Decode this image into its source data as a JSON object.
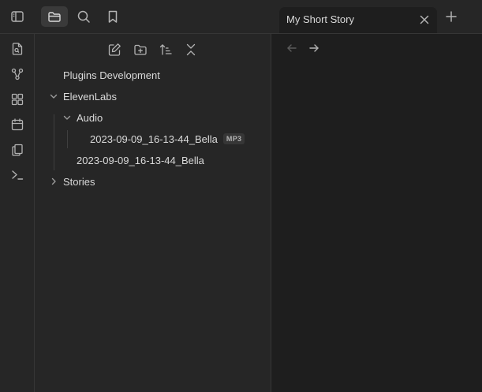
{
  "topbar": {
    "icons": [
      "sidebar-toggle-icon",
      "folder-icon",
      "search-icon",
      "bookmark-icon"
    ],
    "active_tab": "files"
  },
  "tab": {
    "title": "My Short Story"
  },
  "ribbon": {
    "icons": [
      "open-quick-switcher-icon",
      "graph-view-icon",
      "canvas-icon",
      "daily-note-icon",
      "templates-icon",
      "command-palette-icon"
    ]
  },
  "file_explorer": {
    "actions": [
      "new-note-icon",
      "new-folder-icon",
      "sort-icon",
      "collapse-all-icon"
    ],
    "tree": {
      "root_file": "Plugins Development",
      "folder_elevenlabs": "ElevenLabs",
      "folder_audio": "Audio",
      "audio_file": "2023-09-09_16-13-44_Bella",
      "audio_ext": "MP3",
      "note_file": "2023-09-09_16-13-44_Bella",
      "folder_stories": "Stories"
    }
  },
  "colors": {
    "background": "#1e1e1e",
    "panel": "#262626",
    "border": "#363636",
    "text": "#dadada",
    "muted": "#b3b3b3"
  }
}
